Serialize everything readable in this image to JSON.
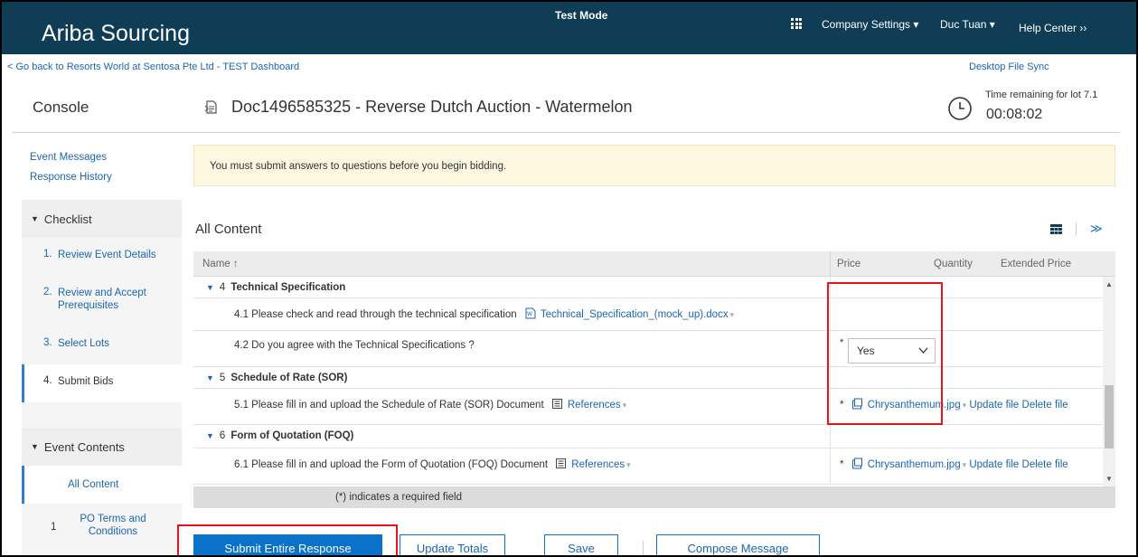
{
  "header": {
    "brand": "Ariba Sourcing",
    "mode": "Test Mode",
    "company_settings": "Company Settings ▾",
    "user": "Duc Tuan ▾",
    "help_center": "Help Center ››"
  },
  "nav": {
    "back_link": "< Go back to Resorts World at Sentosa Pte Ltd - TEST Dashboard",
    "desktop_sync": "Desktop File Sync"
  },
  "page": {
    "console_title": "Console",
    "doc_title": "Doc1496585325 - Reverse Dutch Auction - Watermelon",
    "time_label": "Time remaining for lot 7.1",
    "time_value": "00:08:02"
  },
  "sidebar": {
    "event_messages": "Event Messages",
    "response_history": "Response History",
    "checklist_label": "Checklist",
    "checklist_items": [
      {
        "num": "1.",
        "label": "Review Event Details"
      },
      {
        "num": "2.",
        "label": "Review and Accept Prerequisites"
      },
      {
        "num": "3.",
        "label": "Select Lots"
      },
      {
        "num": "4.",
        "label": "Submit Bids"
      }
    ],
    "event_contents_label": "Event Contents",
    "all_content": "All Content",
    "po_terms_num": "1",
    "po_terms": "PO Terms and Conditions"
  },
  "notice": "You must submit answers to questions before you begin bidding.",
  "content": {
    "title": "All Content",
    "columns": {
      "name": "Name ↑",
      "price": "Price",
      "quantity": "Quantity",
      "extended_price": "Extended Price"
    },
    "rows": {
      "s4_num": "4",
      "s4_label": "Technical Specification",
      "r41_text": "4.1  Please check and read through the technical specification",
      "r41_file": "Technical_Specification_(mock_up).docx",
      "r42_text": "4.2  Do you agree with the Technical Specifications ?",
      "r42_value": "Yes",
      "s5_num": "5",
      "s5_label": "Schedule of Rate (SOR)",
      "r51_text": "5.1  Please fill in and upload the Schedule of Rate (SOR) Document",
      "r51_ref": "References",
      "r51_file": "Chrysanthemum.jpg",
      "s6_num": "6",
      "s6_label": "Form of Quotation (FOQ)",
      "r61_text": "6.1  Please fill in and upload the Form of Quotation (FOQ) Document",
      "r61_ref": "References",
      "r61_file": "Chrysanthemum.jpg",
      "update_file": "Update file",
      "delete_file": "Delete file",
      "required_star": "*"
    },
    "required_note": "(*) indicates a required field"
  },
  "buttons": {
    "submit": "Submit Entire Response",
    "update_totals": "Update Totals",
    "save": "Save",
    "compose": "Compose Message"
  },
  "colors": {
    "header_bg": "#0e3d55",
    "link": "#1a66b3",
    "primary_button": "#0a73c9",
    "highlight": "#e8141b",
    "notice_bg": "#fdf7e0"
  }
}
